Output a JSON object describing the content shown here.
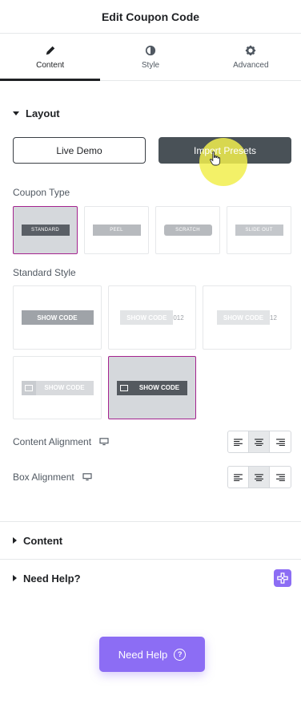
{
  "header": {
    "title": "Edit Coupon Code"
  },
  "tabs": [
    {
      "label": "Content",
      "icon": "pencil-icon",
      "active": true
    },
    {
      "label": "Style",
      "icon": "half-circle-icon",
      "active": false
    },
    {
      "label": "Advanced",
      "icon": "gear-icon",
      "active": false
    }
  ],
  "layout": {
    "title": "Layout",
    "live_demo": "Live Demo",
    "import_presets": "Import Presets",
    "coupon_type_label": "Coupon Type",
    "coupon_types": [
      "STANDARD",
      "PEEL",
      "SCRATCH",
      "SLIDE OUT"
    ],
    "standard_style_label": "Standard Style",
    "show_code": "SHOW CODE",
    "code_suffix": "012",
    "code_suffix_2": "12",
    "content_alignment_label": "Content Alignment",
    "box_alignment_label": "Box Alignment"
  },
  "sections": {
    "content": "Content",
    "need_help": "Need Help?"
  },
  "help_button": {
    "label": "Need Help"
  },
  "colors": {
    "accent": "#a4238f",
    "dark_button": "#495157",
    "help": "#8c6df4",
    "cursor_highlight": "#f1ee4d"
  }
}
